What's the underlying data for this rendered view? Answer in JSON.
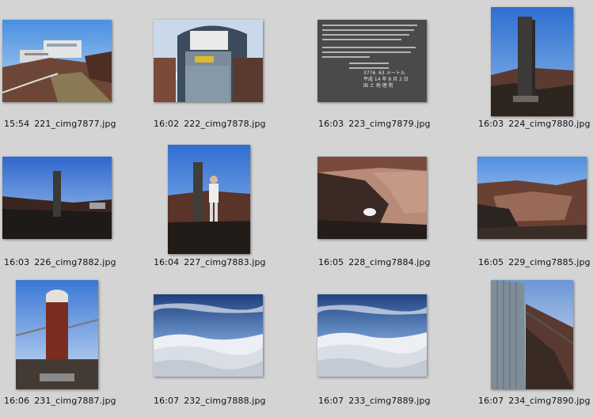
{
  "photos": [
    {
      "time": "15:54",
      "name": "221_cimg7877.jpg",
      "scene": "summit-buildings-path"
    },
    {
      "time": "16:02",
      "name": "222_cimg7878.jpg",
      "scene": "hut-entrance"
    },
    {
      "time": "16:03",
      "name": "223_cimg7879.jpg",
      "scene": "stone-inscription",
      "inscription": [
        "平成 14 年 8 月 2 日",
        "国 土 地 理 院",
        "3776. 63 メートル"
      ]
    },
    {
      "time": "16:03",
      "name": "224_cimg7880.jpg",
      "scene": "monument-pillar-portrait"
    },
    {
      "time": "16:03",
      "name": "226_cimg7882.jpg",
      "scene": "monument-pillar-landscape"
    },
    {
      "time": "16:04",
      "name": "227_cimg7883.jpg",
      "scene": "person-by-pillar"
    },
    {
      "time": "16:05",
      "name": "228_cimg7884.jpg",
      "scene": "crater-view"
    },
    {
      "time": "16:05",
      "name": "229_cimg7885.jpg",
      "scene": "crater-rim"
    },
    {
      "time": "16:06",
      "name": "231_cimg7887.jpg",
      "scene": "red-marker-post"
    },
    {
      "time": "16:07",
      "name": "232_cimg7888.jpg",
      "scene": "sea-of-clouds"
    },
    {
      "time": "16:07",
      "name": "233_cimg7889.jpg",
      "scene": "sea-of-clouds"
    },
    {
      "time": "16:07",
      "name": "234_cimg7890.jpg",
      "scene": "metal-wall-slope"
    }
  ],
  "colors": {
    "background": "#d4d4d4",
    "sky": "#3f7fd6",
    "rock": "#5a3b2e",
    "cloud": "#e8ecf2"
  }
}
